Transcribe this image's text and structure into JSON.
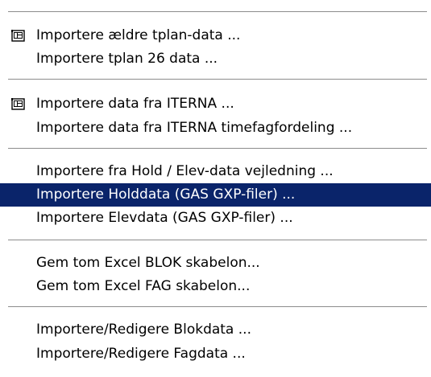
{
  "menu": {
    "groups": [
      {
        "items": [
          {
            "label": "Importere ældre tplan-data ...",
            "icon": "tm-app-icon"
          },
          {
            "label": "Importere tplan 26 data ..."
          }
        ]
      },
      {
        "items": [
          {
            "label": "Importere data fra ITERNA ...",
            "icon": "tm-app-icon"
          },
          {
            "label": "Importere data fra ITERNA timefagfordeling ..."
          }
        ]
      },
      {
        "items": [
          {
            "label": "Importere fra Hold / Elev-data vejledning ..."
          },
          {
            "label": "Importere Holddata (GAS GXP-filer) ...",
            "selected": true
          },
          {
            "label": "Importere Elevdata (GAS GXP-filer) ..."
          }
        ]
      },
      {
        "items": [
          {
            "label": "Gem tom Excel BLOK skabelon..."
          },
          {
            "label": "Gem tom Excel FAG skabelon..."
          }
        ]
      },
      {
        "items": [
          {
            "label": "Importere/Redigere Blokdata ..."
          },
          {
            "label": "Importere/Redigere Fagdata ..."
          }
        ]
      }
    ],
    "colors": {
      "selection_background": "#0a246a",
      "selection_text": "#ffffff",
      "separator": "#8c8c8c",
      "background": "#ffffff"
    }
  }
}
